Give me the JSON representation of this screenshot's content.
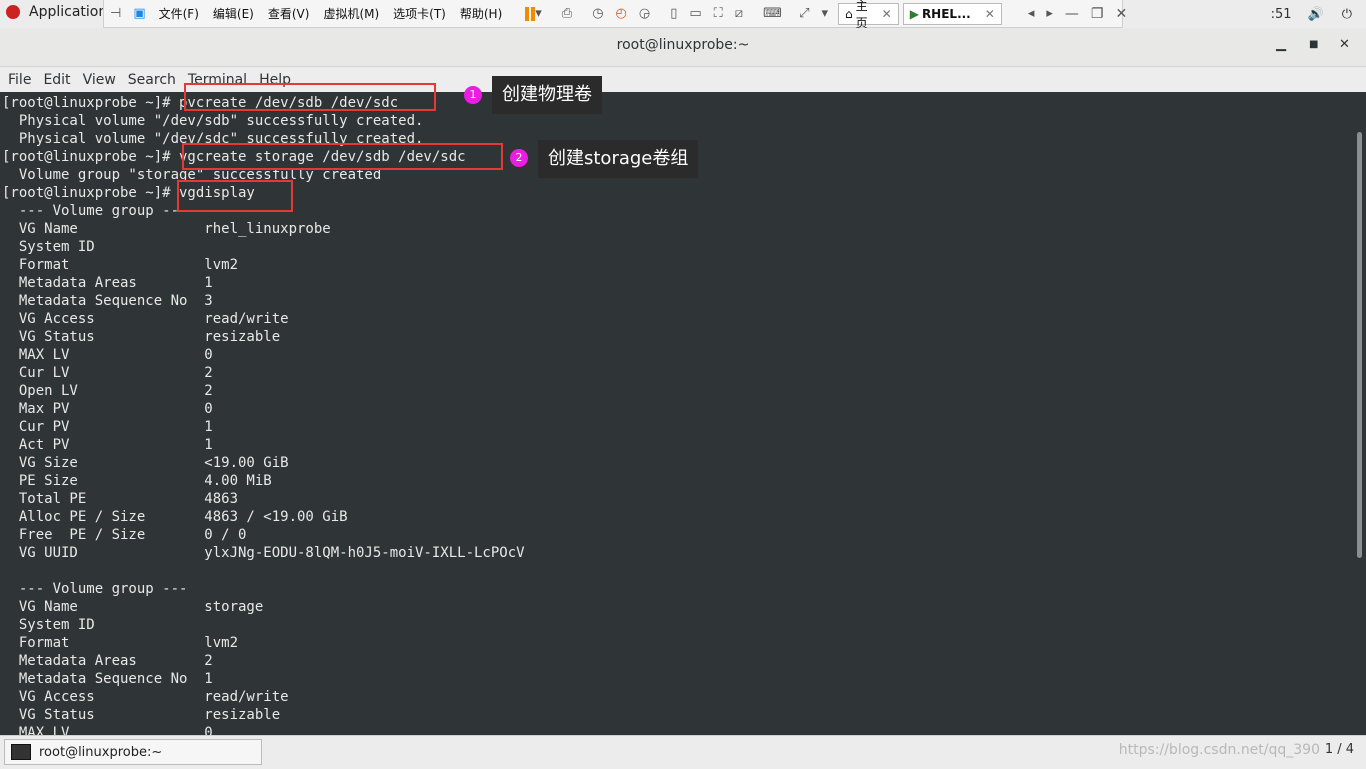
{
  "gnome": {
    "applications_label": "Application",
    "clock": ":51"
  },
  "vm": {
    "menus": [
      "文件(F)",
      "编辑(E)",
      "查看(V)",
      "虚拟机(M)",
      "选项卡(T)",
      "帮助(H)"
    ],
    "tabs": [
      {
        "label": "主页"
      },
      {
        "label": "RHEL..."
      }
    ]
  },
  "window": {
    "title": "root@linuxprobe:~"
  },
  "menubar": [
    "File",
    "Edit",
    "View",
    "Search",
    "Terminal",
    "Help"
  ],
  "terminal": {
    "lines": [
      "[root@linuxprobe ~]# pvcreate /dev/sdb /dev/sdc",
      "  Physical volume \"/dev/sdb\" successfully created.",
      "  Physical volume \"/dev/sdc\" successfully created.",
      "[root@linuxprobe ~]# vgcreate storage /dev/sdb /dev/sdc",
      "  Volume group \"storage\" successfully created",
      "[root@linuxprobe ~]# vgdisplay",
      "  --- Volume group ---",
      "  VG Name               rhel_linuxprobe",
      "  System ID",
      "  Format                lvm2",
      "  Metadata Areas        1",
      "  Metadata Sequence No  3",
      "  VG Access             read/write",
      "  VG Status             resizable",
      "  MAX LV                0",
      "  Cur LV                2",
      "  Open LV               2",
      "  Max PV                0",
      "  Cur PV                1",
      "  Act PV                1",
      "  VG Size               <19.00 GiB",
      "  PE Size               4.00 MiB",
      "  Total PE              4863",
      "  Alloc PE / Size       4863 / <19.00 GiB",
      "  Free  PE / Size       0 / 0",
      "  VG UUID               ylxJNg-EODU-8lQM-h0J5-moiV-IXLL-LcPOcV",
      "",
      "  --- Volume group ---",
      "  VG Name               storage",
      "  System ID",
      "  Format                lvm2",
      "  Metadata Areas        2",
      "  Metadata Sequence No  1",
      "  VG Access             read/write",
      "  VG Status             resizable",
      "  MAX LV                0"
    ]
  },
  "annotations": [
    {
      "number": "1",
      "text": "创建物理卷"
    },
    {
      "number": "2",
      "text": "创建storage卷组"
    }
  ],
  "taskbar": {
    "item_label": "root@linuxprobe:~",
    "watermark": "https://blog.csdn.net/qq_390",
    "pager": "1 / 4"
  },
  "colors": {
    "highlight": "#e53935",
    "badge": "#e91ee0",
    "terminal_bg": "#2f3436",
    "pause": "#f08c00"
  }
}
